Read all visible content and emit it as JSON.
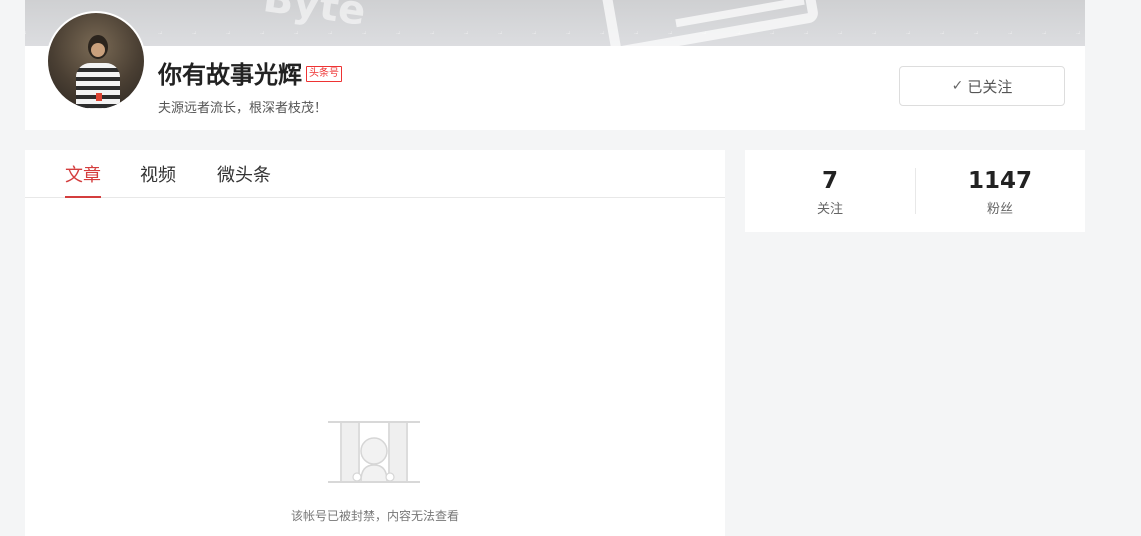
{
  "profile": {
    "banner_word": "Byte",
    "name": "你有故事光辉",
    "tag": "头条号",
    "motto": "夫源远者流长，根深者枝茂！",
    "follow_button": {
      "icon": "check-icon",
      "label": "已关注"
    }
  },
  "tabs": [
    {
      "label": "文章",
      "active": true
    },
    {
      "label": "视频",
      "active": false
    },
    {
      "label": "微头条",
      "active": false
    }
  ],
  "empty_state": {
    "icon": "banned-cage-icon",
    "message": "该帐号已被封禁，内容无法查看"
  },
  "stats": [
    {
      "value": "7",
      "label": "关注"
    },
    {
      "value": "1147",
      "label": "粉丝"
    }
  ],
  "colors": {
    "accent": "#d43d3d",
    "tag": "#ee3333",
    "background": "#f4f5f6"
  }
}
